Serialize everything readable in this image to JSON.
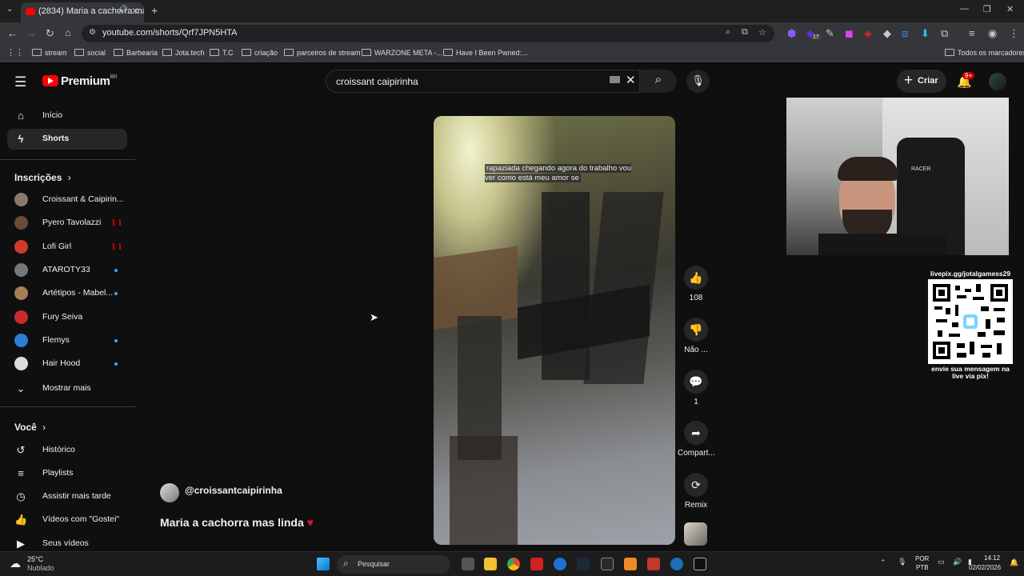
{
  "browser": {
    "tab_title": "(2834) Maria a cachorra ma...",
    "url": "youtube.com/shorts/Qrf7JPN5HTA",
    "bookmarks": [
      "stream",
      "social",
      "Barbearia",
      "Jota.tech",
      "T.C",
      "criação",
      "parceiros de stream",
      "WARZONE META -...",
      "Have I Been Pwned:..."
    ],
    "all_bookmarks": "Todos os marcadores",
    "ext_badge": "17"
  },
  "header": {
    "logo": "Premium",
    "logo_region": "BR",
    "search_value": "croissant caipirinha",
    "create_label": "Criar",
    "notif_badge": "9+"
  },
  "sidebar": {
    "main": [
      {
        "label": "Início",
        "icon": "home-icon"
      },
      {
        "label": "Shorts",
        "icon": "shorts-icon"
      }
    ],
    "subscriptions_title": "Inscrições",
    "subscriptions": [
      {
        "label": "Croissant & Caipirin...",
        "color": "#8b7a6b",
        "status": "none"
      },
      {
        "label": "Pyero Tavolazzi",
        "color": "#6a4a3a",
        "status": "live"
      },
      {
        "label": "Lofi Girl",
        "color": "#d23a2f",
        "status": "live"
      },
      {
        "label": "ATAROTY33",
        "color": "#777777",
        "status": "new"
      },
      {
        "label": "Artétipos - Mabel...",
        "color": "#a87c54",
        "status": "new"
      },
      {
        "label": "Fury Seiva",
        "color": "#c92a2a",
        "status": "none"
      },
      {
        "label": "Flemys",
        "color": "#2a7fd4",
        "status": "new"
      },
      {
        "label": "Hair Hood",
        "color": "#dddddd",
        "status": "new"
      }
    ],
    "show_more": "Mostrar mais",
    "you_title": "Você",
    "you_items": [
      {
        "label": "Histórico",
        "icon": "history-icon"
      },
      {
        "label": "Playlists",
        "icon": "playlists-icon"
      },
      {
        "label": "Assistir mais tarde",
        "icon": "watch-later-icon"
      },
      {
        "label": "Vídeos com \"Gostei\"",
        "icon": "like-icon"
      },
      {
        "label": "Seus vídeos",
        "icon": "your-videos-icon"
      }
    ]
  },
  "short": {
    "caption": "rapaziada chegando agora do trabalho vou ver como está meu amor se",
    "channel": "@croissantcaipirinha",
    "title": "Maria a cachorra mas linda",
    "actions": {
      "like_count": "108",
      "dislike_label": "Não ...",
      "comment_count": "1",
      "share_label": "Compart...",
      "remix_label": "Remix"
    }
  },
  "overlay": {
    "qr_url": "livepix.gg/jotalgamess29",
    "qr_note": "envie sua mensagem na live via pix!",
    "cam_chair_brand": "RACER"
  },
  "taskbar": {
    "weather_temp": "25°C",
    "weather_desc": "Nublado",
    "search_label": "Pesquisar",
    "lang_top": "POR",
    "lang_bottom": "PTB",
    "time": "14:12",
    "date": "02/02/2026"
  }
}
